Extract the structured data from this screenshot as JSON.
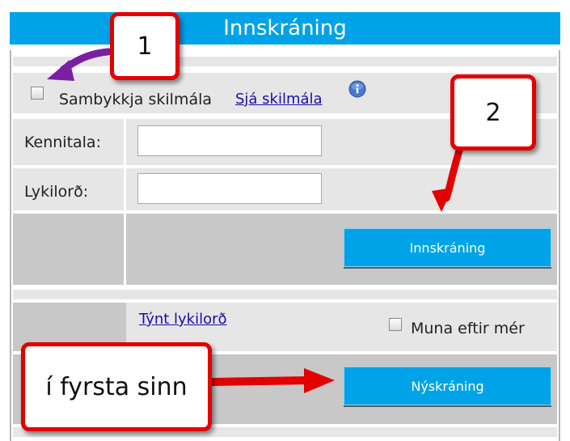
{
  "header": {
    "title": "Innskráning"
  },
  "terms": {
    "checkbox_label": "Sambykkja skilmála",
    "link": "Sjá skilmála",
    "info_icon": "info-icon"
  },
  "form": {
    "kennitala_label": "Kennitala:",
    "kennitala_value": "",
    "password_label": "Lykilorð:",
    "password_value": "",
    "login_button": "Innskráning"
  },
  "extras": {
    "forgot_link": "Týnt lykilorð",
    "remember_label": "Muna eftir mér",
    "register_button": "Nýskráning"
  },
  "callouts": {
    "one": "1",
    "two": "2",
    "first_time": "í fyrsta sinn"
  },
  "colors": {
    "accent": "#00a3e8",
    "callout_border": "#e30000",
    "arrow_red": "#e30000",
    "arrow_purple": "#7b1fa2"
  }
}
